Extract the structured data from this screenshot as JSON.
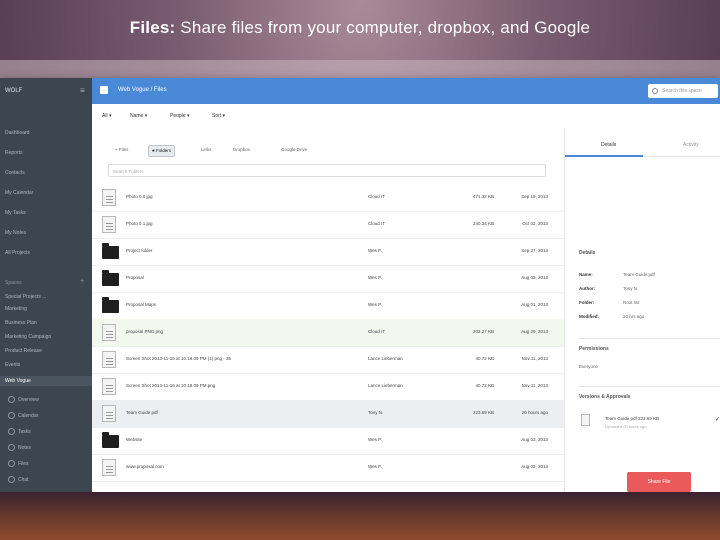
{
  "headline": {
    "bold": "Files:",
    "rest": " Share files from your computer, dropbox, and Google"
  },
  "sidebar": {
    "brand": "WOLF",
    "items": [
      "Dashboard",
      "Reports",
      "Contacts",
      "My Calendar",
      "My Tasks",
      "My Notes",
      "All Projects"
    ],
    "section_label": "Spaces",
    "spaces": [
      "Special Projects ...",
      "Marketing",
      "Business Plan",
      "Marketing Campaign",
      "Product Release",
      "Events"
    ],
    "active_space": "Web Vogue",
    "space_subitems": [
      "Overview",
      "Calendar",
      "Tasks",
      "Notes",
      "Files",
      "Chat"
    ]
  },
  "topbar": {
    "title": "Web Vogue / Files",
    "search_placeholder": "Search this space"
  },
  "filters": [
    "All ▾",
    "Name ▾",
    "People ▾",
    "Sort ▾"
  ],
  "sources": [
    "+ Files",
    "● Folders",
    "Links",
    "Dropbox",
    "Google Drive"
  ],
  "search_files_placeholder": "Search Folders",
  "files": [
    {
      "type": "file",
      "name": "Photo 0.0.jpg",
      "owner": "Cloud IT",
      "size": "471.32 KB",
      "date": "Sep 19, 2013"
    },
    {
      "type": "file",
      "name": "Photo 0.1.jpg",
      "owner": "Cloud IT",
      "size": "240.34 KB",
      "date": "Oct 02, 2013"
    },
    {
      "type": "folder",
      "name": "Project folder",
      "owner": "Wes P.",
      "size": "",
      "date": "Sep 27, 2013"
    },
    {
      "type": "folder",
      "name": "Proposal",
      "owner": "Wes P.",
      "size": "",
      "date": "Aug 03, 2013"
    },
    {
      "type": "folder",
      "name": "Proposal Maps",
      "owner": "Wes P.",
      "size": "",
      "date": "Aug 01, 2013"
    },
    {
      "type": "file",
      "name": "proposal PNG.png",
      "owner": "Cloud IT",
      "size": "203.27 KB",
      "date": "Aug 29, 2013"
    },
    {
      "type": "file",
      "name": "Screen Shot 2013-11-16 at 10.18.09 PM (1).png - 36",
      "owner": "Lance Lieberman",
      "size": "40.72 KB",
      "date": "Nov 11, 2013"
    },
    {
      "type": "file",
      "name": "Screen Shot 2013-11-16 at 10.18.09 PM.png",
      "owner": "Lance Lieberman",
      "size": "40.72 KB",
      "date": "Nov 11, 2013"
    },
    {
      "type": "file",
      "name": "Team Guide.pdf",
      "owner": "Tony N.",
      "size": "223.69 KB",
      "date": "20 hours ago"
    },
    {
      "type": "folder",
      "name": "Website",
      "owner": "Wes P.",
      "size": "",
      "date": "Aug 03, 2013"
    },
    {
      "type": "file",
      "name": "www.proposal.com",
      "owner": "Wes P.",
      "size": "",
      "date": "Aug 03, 2013"
    }
  ],
  "panel": {
    "tabs": [
      "Details",
      "Activity"
    ],
    "details_title": "Details",
    "details": [
      {
        "k": "Name:",
        "v": "Team Guide.pdf"
      },
      {
        "k": "Author:",
        "v": "Tony N."
      },
      {
        "k": "Folder:",
        "v": "Root list"
      },
      {
        "k": "Modified:",
        "v": "20 hrs ago"
      }
    ],
    "permissions_title": "Permissions",
    "permissions_value": "Everyone",
    "versions_title": "Versions & Approvals",
    "attachment_name": "Team Guide.pdf 223.69 KB",
    "attachment_sub": "Uploaded 20 hours ago",
    "share_button": "Share File"
  }
}
